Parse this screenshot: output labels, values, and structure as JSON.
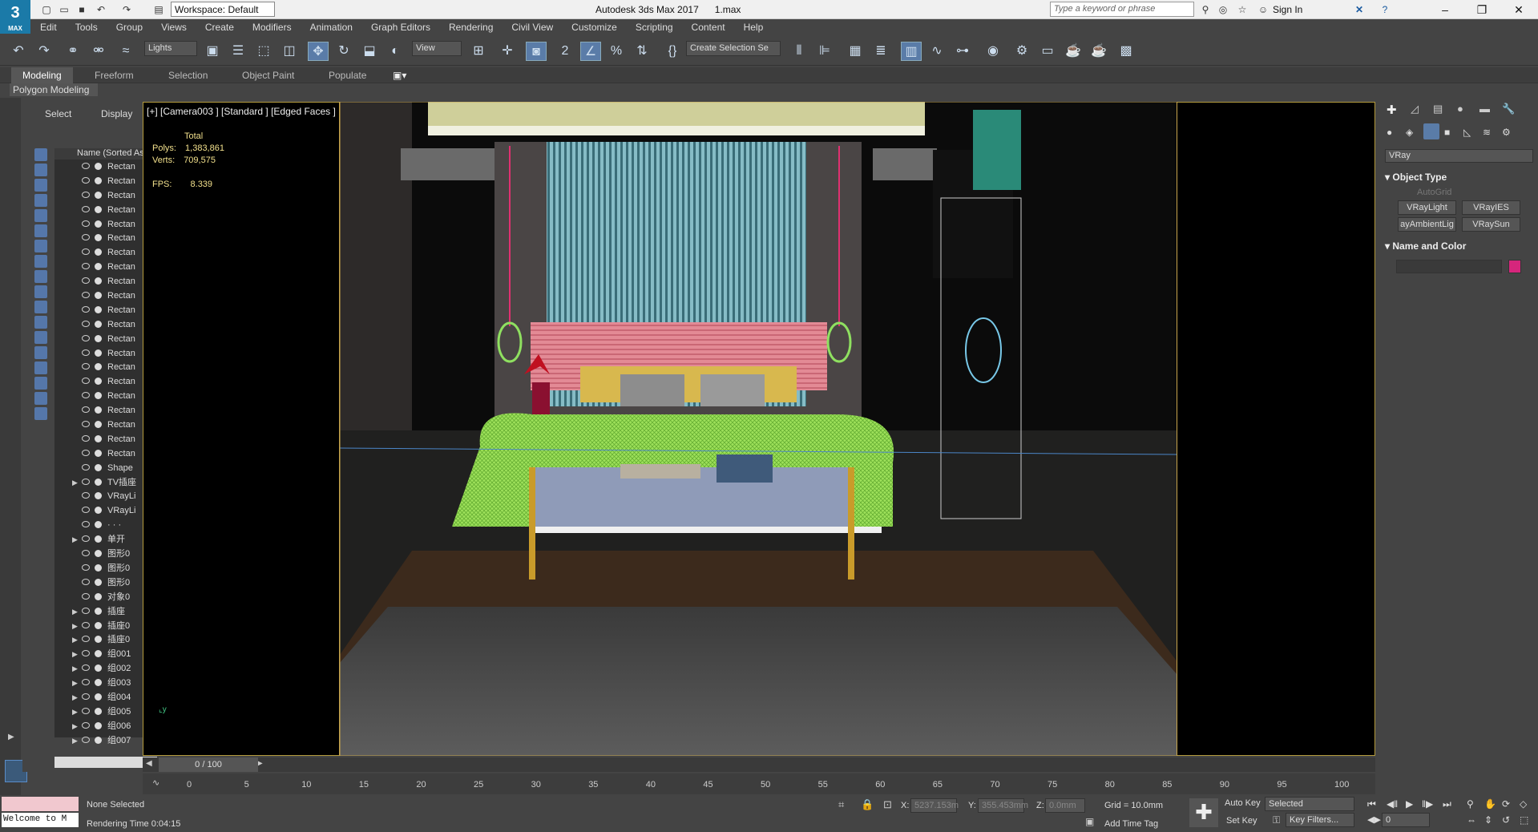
{
  "title": "Autodesk 3ds Max 2017      1.max",
  "workspace": "Workspace: Default",
  "search_placeholder": "Type a keyword or phrase",
  "sign_in": "Sign In",
  "logo": {
    "big": "3",
    "small": "MAX"
  },
  "menu": [
    "Edit",
    "Tools",
    "Group",
    "Views",
    "Create",
    "Modifiers",
    "Animation",
    "Graph Editors",
    "Rendering",
    "Civil View",
    "Customize",
    "Scripting",
    "Content",
    "Help"
  ],
  "toolbar": {
    "filter": "Lights",
    "refcoord": "View",
    "selset": "Create Selection Se"
  },
  "ribbon": {
    "tabs": [
      "Modeling",
      "Freeform",
      "Selection",
      "Object Paint",
      "Populate"
    ],
    "sub": "Polygon Modeling"
  },
  "scene_explorer": {
    "tab_select": "Select",
    "tab_display": "Display",
    "column_header": "Name (Sorted Ascen",
    "rows": [
      {
        "name": "Rectan",
        "expand": ""
      },
      {
        "name": "Rectan",
        "expand": ""
      },
      {
        "name": "Rectan",
        "expand": ""
      },
      {
        "name": "Rectan",
        "expand": ""
      },
      {
        "name": "Rectan",
        "expand": ""
      },
      {
        "name": "Rectan",
        "expand": ""
      },
      {
        "name": "Rectan",
        "expand": ""
      },
      {
        "name": "Rectan",
        "expand": ""
      },
      {
        "name": "Rectan",
        "expand": ""
      },
      {
        "name": "Rectan",
        "expand": ""
      },
      {
        "name": "Rectan",
        "expand": ""
      },
      {
        "name": "Rectan",
        "expand": ""
      },
      {
        "name": "Rectan",
        "expand": ""
      },
      {
        "name": "Rectan",
        "expand": ""
      },
      {
        "name": "Rectan",
        "expand": ""
      },
      {
        "name": "Rectan",
        "expand": ""
      },
      {
        "name": "Rectan",
        "expand": ""
      },
      {
        "name": "Rectan",
        "expand": ""
      },
      {
        "name": "Rectan",
        "expand": ""
      },
      {
        "name": "Rectan",
        "expand": ""
      },
      {
        "name": "Rectan",
        "expand": ""
      },
      {
        "name": "Shape",
        "expand": ""
      },
      {
        "name": "TV插座",
        "expand": "▶"
      },
      {
        "name": "VRayLi",
        "expand": ""
      },
      {
        "name": "VRayLi",
        "expand": ""
      },
      {
        "name": "· · ·",
        "expand": ""
      },
      {
        "name": "单开",
        "expand": "▶"
      },
      {
        "name": "图形0",
        "expand": ""
      },
      {
        "name": "图形0",
        "expand": ""
      },
      {
        "name": "图形0",
        "expand": ""
      },
      {
        "name": "对象0",
        "expand": ""
      },
      {
        "name": "插座",
        "expand": "▶"
      },
      {
        "name": "插座0",
        "expand": "▶"
      },
      {
        "name": "插座0",
        "expand": "▶"
      },
      {
        "name": "组001",
        "expand": "▶"
      },
      {
        "name": "组002",
        "expand": "▶"
      },
      {
        "name": "组003",
        "expand": "▶"
      },
      {
        "name": "组004",
        "expand": "▶"
      },
      {
        "name": "组005",
        "expand": "▶"
      },
      {
        "name": "组006",
        "expand": "▶"
      },
      {
        "name": "组007",
        "expand": "▶"
      }
    ]
  },
  "viewport": {
    "label": "[+] [Camera003 ] [Standard ] [Edged Faces ]",
    "stats_total": "Total",
    "polys_label": "Polys:",
    "polys": "1,383,861",
    "verts_label": "Verts:",
    "verts": "709,575",
    "fps_label": "FPS:",
    "fps": "8.339"
  },
  "command_panel": {
    "category": "VRay",
    "object_type": "Object Type",
    "autogrid": "AutoGrid",
    "buttons": [
      "VRayLight",
      "VRayIES",
      "ayAmbientLig",
      "VRaySun"
    ],
    "name_color": "Name and Color",
    "color": "#d6267c"
  },
  "timeline": {
    "counter": "0 / 100",
    "ticks": [
      "0",
      "5",
      "10",
      "15",
      "20",
      "25",
      "30",
      "35",
      "40",
      "45",
      "50",
      "55",
      "60",
      "65",
      "70",
      "75",
      "80",
      "85",
      "90",
      "95",
      "100"
    ]
  },
  "status": {
    "maxscript": "Welcome to M",
    "selection": "None Selected",
    "render_time": "Rendering Time  0:04:15",
    "x_label": "X:",
    "x": "5237.153m",
    "y_label": "Y:",
    "y": "355.453mm",
    "z_label": "Z:",
    "z": "0.0mm",
    "grid": "Grid = 10.0mm",
    "add_time_tag": "Add Time Tag",
    "auto_key": "Auto Key",
    "selected": "Selected",
    "set_key": "Set Key",
    "key_filters": "Key Filters...",
    "frame": "0"
  }
}
